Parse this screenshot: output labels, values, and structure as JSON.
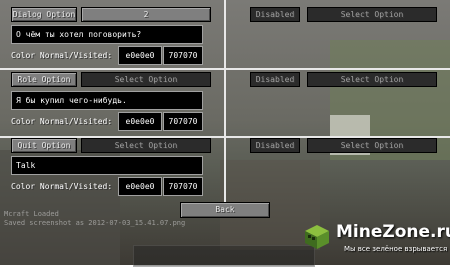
{
  "rows": [
    {
      "left_button": "Dialog Option",
      "right_button": "2",
      "text": "О чём ты хотел поговорить?",
      "color_label": "Color Normal/Visited:",
      "color_normal": "e0e0e0",
      "color_visited": "707070",
      "disabled_label": "Disabled",
      "select_label": "Select Option"
    },
    {
      "left_button": "Role Option",
      "right_button": "Select Option",
      "text": "Я бы купил чего-нибудь.",
      "color_label": "Color Normal/Visited:",
      "color_normal": "e0e0e0",
      "color_visited": "707070",
      "disabled_label": "Disabled",
      "select_label": "Select Option"
    },
    {
      "left_button": "Quit Option",
      "right_button": "Select Option",
      "text": "Talk",
      "color_label": "Color Normal/Visited:",
      "color_normal": "e0e0e0",
      "color_visited": "707070",
      "disabled_label": "Disabled",
      "select_label": "Select Option"
    }
  ],
  "back_button": "Back",
  "log_lines": [
    "Mcraft Loaded",
    "Saved screenshot as 2012-07-03_15.41.07.png"
  ],
  "logo": {
    "title": "MineZone.ru",
    "subtitle": "Мы все зелёное взрывается"
  }
}
